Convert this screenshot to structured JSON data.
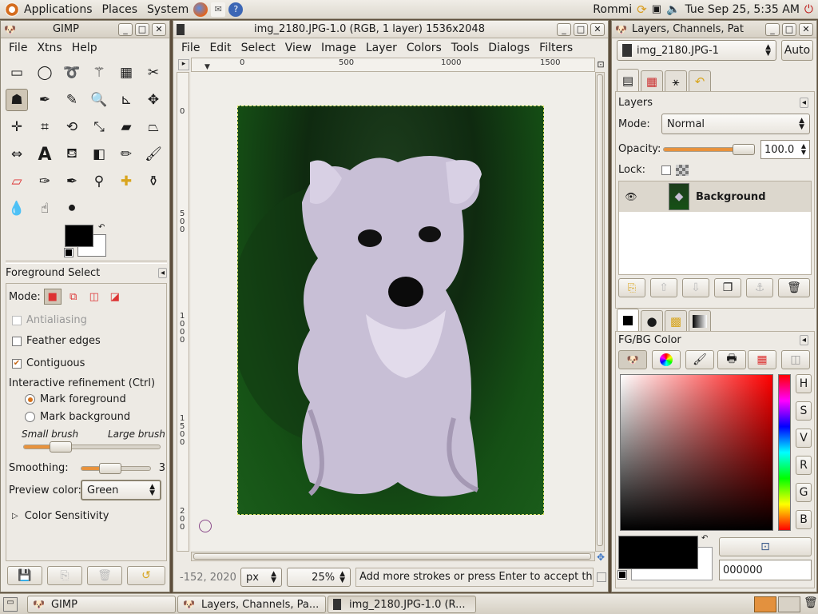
{
  "panel": {
    "menus": [
      "Applications",
      "Places",
      "System"
    ],
    "user": "Rommi",
    "clock": "Tue Sep 25,  5:35 AM"
  },
  "toolbox": {
    "title": "GIMP",
    "menus": [
      "File",
      "Xtns",
      "Help"
    ],
    "options_title": "Foreground Select",
    "mode_label": "Mode:",
    "antialiasing": "Antialiasing",
    "feather": "Feather edges",
    "contiguous": "Contiguous",
    "refinement_label": "Interactive refinement  (Ctrl)",
    "mark_fg": "Mark foreground",
    "mark_bg": "Mark background",
    "small_brush": "Small brush",
    "large_brush": "Large brush",
    "smoothing_label": "Smoothing:",
    "smoothing_value": "3",
    "preview_label": "Preview color:",
    "preview_value": "Green",
    "sensitivity": "Color Sensitivity"
  },
  "image_window": {
    "title": "img_2180.JPG-1.0 (RGB, 1 layer) 1536x2048",
    "menus": [
      "File",
      "Edit",
      "Select",
      "View",
      "Image",
      "Layer",
      "Colors",
      "Tools",
      "Dialogs",
      "Filters"
    ],
    "hruler": [
      "0",
      "500",
      "1000",
      "1500"
    ],
    "vruler": [
      "0",
      "5\n0\n0",
      "1\n0\n0\n0",
      "1\n5\n0\n0",
      "2\n0\n0"
    ],
    "coords": "-152, 2020",
    "unit": "px",
    "zoom": "25%",
    "status": "Add more strokes or press Enter to accept the..."
  },
  "layers": {
    "title": "Layers, Channels, Pat",
    "image_select": "img_2180.JPG-1",
    "auto_btn": "Auto",
    "section": "Layers",
    "mode_label": "Mode:",
    "mode_value": "Normal",
    "opacity_label": "Opacity:",
    "opacity_value": "100.0",
    "lock_label": "Lock:",
    "layer_name": "Background"
  },
  "fgbg": {
    "section": "FG/BG Color",
    "channels": [
      "H",
      "S",
      "V",
      "R",
      "G",
      "B"
    ],
    "hex": "000000"
  },
  "taskbar": {
    "tasks": [
      "GIMP",
      "Layers, Channels, Pa...",
      "img_2180.JPG-1.0 (R..."
    ]
  },
  "colors": {
    "preview_green": "#1f6b1f",
    "accent": "#e8923c"
  }
}
